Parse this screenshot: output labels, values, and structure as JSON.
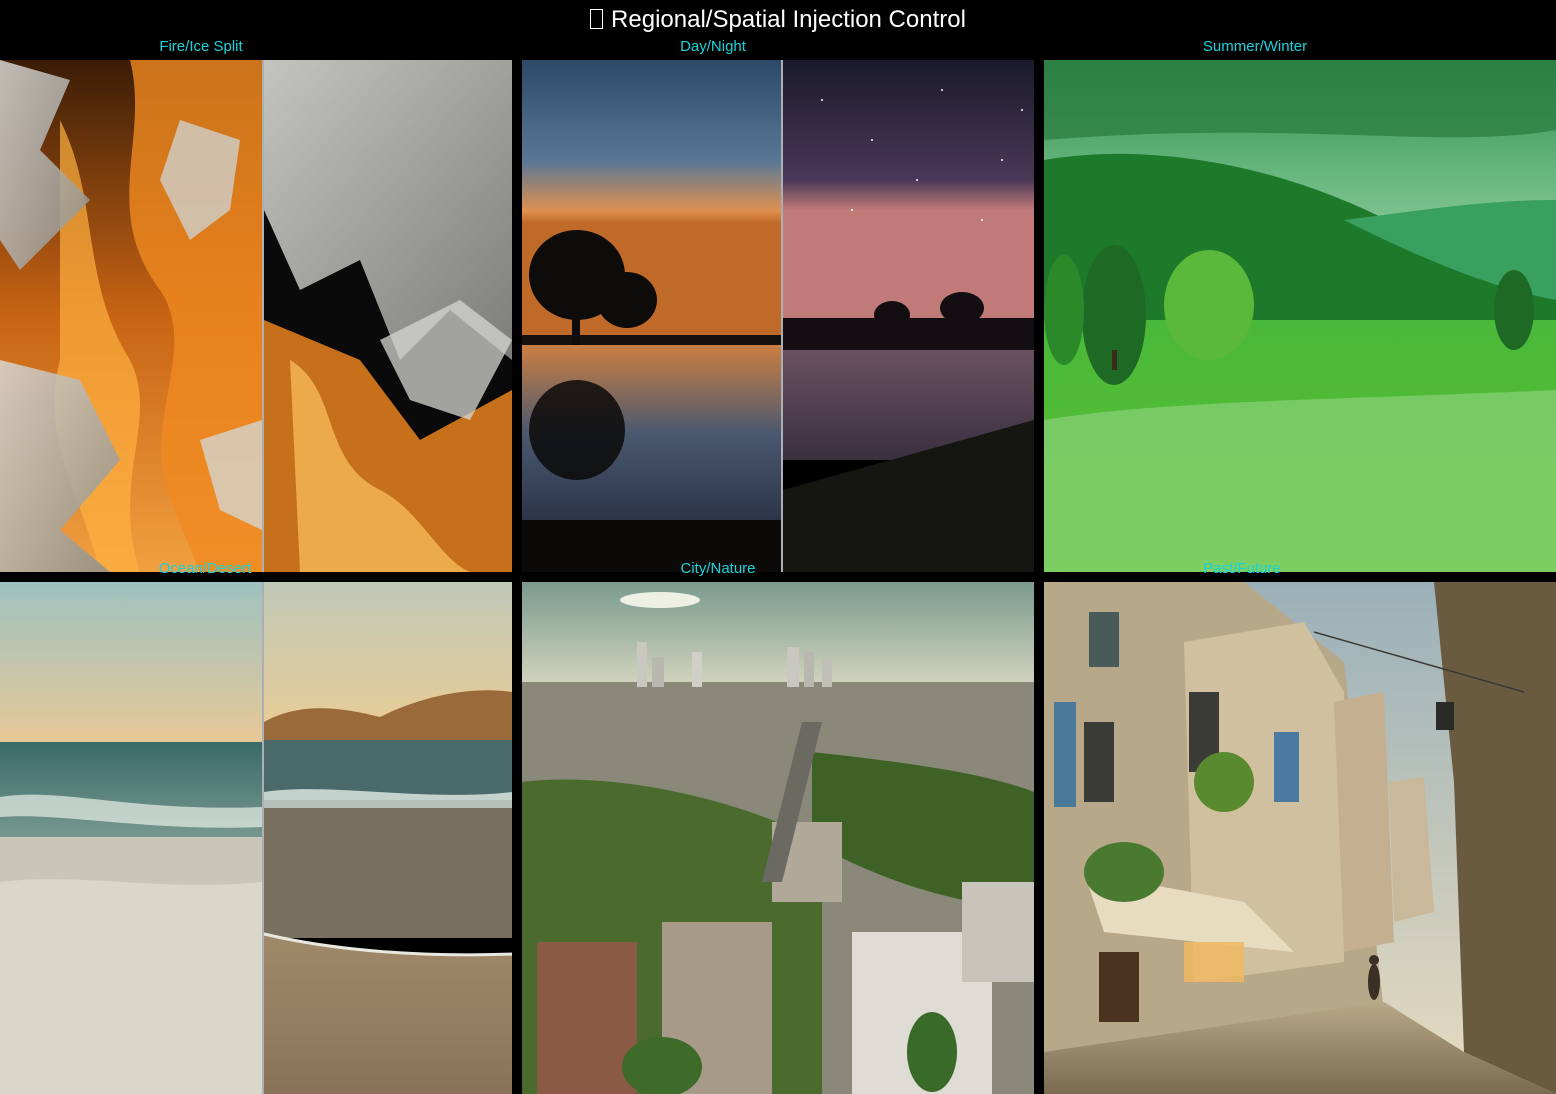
{
  "title": {
    "icon": "box-glyph-icon",
    "text": "Regional/Spatial Injection Control"
  },
  "panels": [
    {
      "caption": "Fire/Ice Split"
    },
    {
      "caption": "Day/Night"
    },
    {
      "caption": "Summer/Winter"
    },
    {
      "caption": "Ocean/Desert"
    },
    {
      "caption": "City/Nature"
    },
    {
      "caption": "Past/Future"
    }
  ],
  "colors": {
    "background": "#000000",
    "title": "#ffffff",
    "caption": "#19d3dc"
  }
}
